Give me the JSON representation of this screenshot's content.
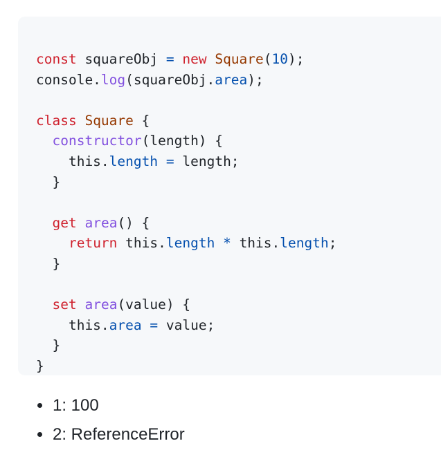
{
  "code": {
    "lines": [
      [
        {
          "t": "const",
          "k": "keyword"
        },
        {
          "t": " squareObj ",
          "k": "plain"
        },
        {
          "t": "=",
          "k": "op"
        },
        {
          "t": " ",
          "k": "plain"
        },
        {
          "t": "new",
          "k": "keyword"
        },
        {
          "t": " ",
          "k": "plain"
        },
        {
          "t": "Square",
          "k": "class"
        },
        {
          "t": "(",
          "k": "plain"
        },
        {
          "t": "10",
          "k": "number"
        },
        {
          "t": ");",
          "k": "plain"
        }
      ],
      [
        {
          "t": "console.",
          "k": "plain"
        },
        {
          "t": "log",
          "k": "func"
        },
        {
          "t": "(squareObj.",
          "k": "plain"
        },
        {
          "t": "area",
          "k": "prop"
        },
        {
          "t": ");",
          "k": "plain"
        }
      ],
      [],
      [
        {
          "t": "class",
          "k": "keyword"
        },
        {
          "t": " ",
          "k": "plain"
        },
        {
          "t": "Square",
          "k": "class"
        },
        {
          "t": " {",
          "k": "plain"
        }
      ],
      [
        {
          "t": "  ",
          "k": "plain"
        },
        {
          "t": "constructor",
          "k": "func"
        },
        {
          "t": "(length) {",
          "k": "plain"
        }
      ],
      [
        {
          "t": "    this.",
          "k": "plain"
        },
        {
          "t": "length",
          "k": "prop"
        },
        {
          "t": " ",
          "k": "plain"
        },
        {
          "t": "=",
          "k": "op"
        },
        {
          "t": " length;",
          "k": "plain"
        }
      ],
      [
        {
          "t": "  }",
          "k": "plain"
        }
      ],
      [],
      [
        {
          "t": "  ",
          "k": "plain"
        },
        {
          "t": "get",
          "k": "keyword"
        },
        {
          "t": " ",
          "k": "plain"
        },
        {
          "t": "area",
          "k": "func"
        },
        {
          "t": "() {",
          "k": "plain"
        }
      ],
      [
        {
          "t": "    ",
          "k": "plain"
        },
        {
          "t": "return",
          "k": "keyword"
        },
        {
          "t": " this.",
          "k": "plain"
        },
        {
          "t": "length",
          "k": "prop"
        },
        {
          "t": " ",
          "k": "plain"
        },
        {
          "t": "*",
          "k": "op"
        },
        {
          "t": " this.",
          "k": "plain"
        },
        {
          "t": "length",
          "k": "prop"
        },
        {
          "t": ";",
          "k": "plain"
        }
      ],
      [
        {
          "t": "  }",
          "k": "plain"
        }
      ],
      [],
      [
        {
          "t": "  ",
          "k": "plain"
        },
        {
          "t": "set",
          "k": "keyword"
        },
        {
          "t": " ",
          "k": "plain"
        },
        {
          "t": "area",
          "k": "func"
        },
        {
          "t": "(value) {",
          "k": "plain"
        }
      ],
      [
        {
          "t": "    this.",
          "k": "plain"
        },
        {
          "t": "area",
          "k": "prop"
        },
        {
          "t": " ",
          "k": "plain"
        },
        {
          "t": "=",
          "k": "op"
        },
        {
          "t": " value;",
          "k": "plain"
        }
      ],
      [
        {
          "t": "  }",
          "k": "plain"
        }
      ],
      [
        {
          "t": "}",
          "k": "plain"
        }
      ]
    ]
  },
  "answers": [
    "1: 100",
    "2: ReferenceError"
  ]
}
